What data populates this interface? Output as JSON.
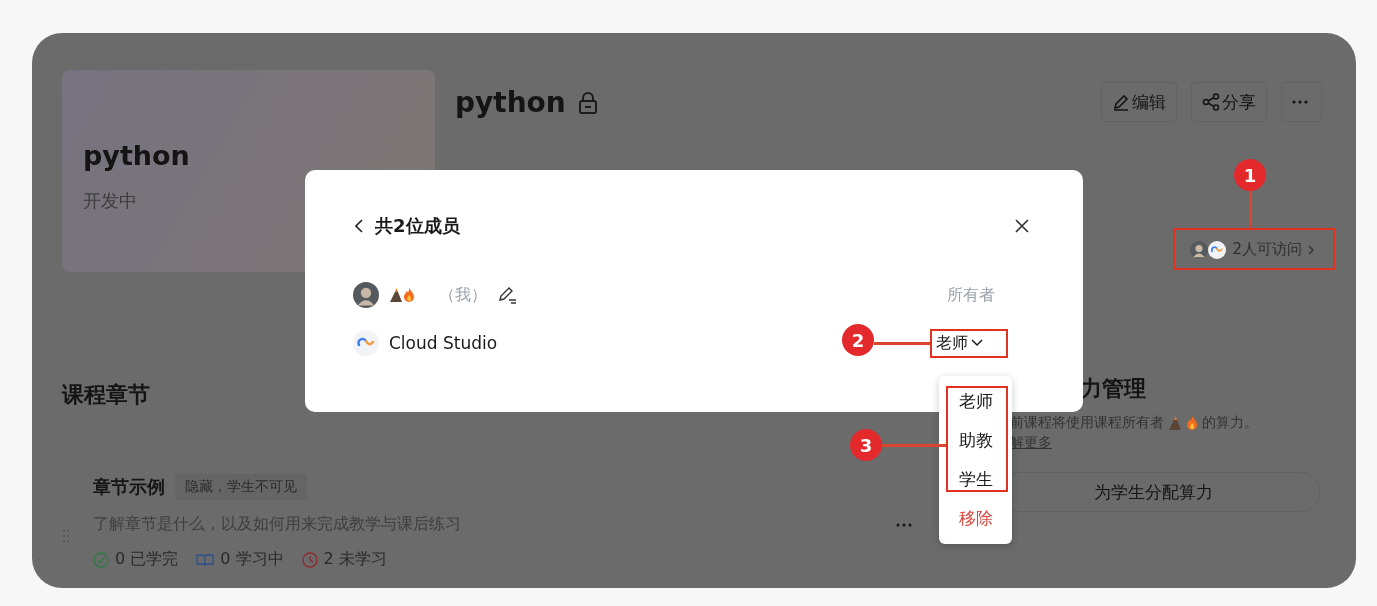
{
  "course_cover": {
    "title": "python",
    "status": "开发中"
  },
  "course": {
    "title": "python",
    "locked": true
  },
  "actions": [
    {
      "kind": "edit",
      "label": "编辑"
    },
    {
      "kind": "share",
      "label": "分享"
    },
    {
      "kind": "more"
    }
  ],
  "access": {
    "label": "2人可访问"
  },
  "chapters_section": {
    "title": "课程章节",
    "chapters": [
      {
        "title": "章节示例",
        "tag": "隐藏，学生不可见",
        "description": "了解章节是什么，以及如何用来完成教学与课后练习",
        "stats": [
          {
            "kind": "done",
            "count": "0",
            "label": "已学完"
          },
          {
            "kind": "learning",
            "count": "0",
            "label": "学习中"
          },
          {
            "kind": "todo",
            "count": "2",
            "label": "未学习"
          }
        ]
      }
    ]
  },
  "compute_panel": {
    "title": "力管理",
    "description_start": "前课程将使用课程所有者",
    "description_end": "的算力。",
    "link": "解更多",
    "button": "为学生分配算力"
  },
  "members_dialog": {
    "title": "共2位成员",
    "members": [
      {
        "kind": "self",
        "note": "（我）",
        "role": "所有者",
        "editable_role": false
      },
      {
        "kind": "app",
        "name": "Cloud Studio",
        "role": "老师",
        "editable_role": true
      }
    ]
  },
  "role_menu": {
    "items": [
      {
        "label": "老师",
        "kind": "role"
      },
      {
        "label": "助教",
        "kind": "role"
      },
      {
        "label": "学生",
        "kind": "role"
      },
      {
        "label": "移除",
        "kind": "danger"
      }
    ]
  },
  "annotations": [
    {
      "label": "1"
    },
    {
      "label": "2"
    },
    {
      "label": "3"
    }
  ]
}
